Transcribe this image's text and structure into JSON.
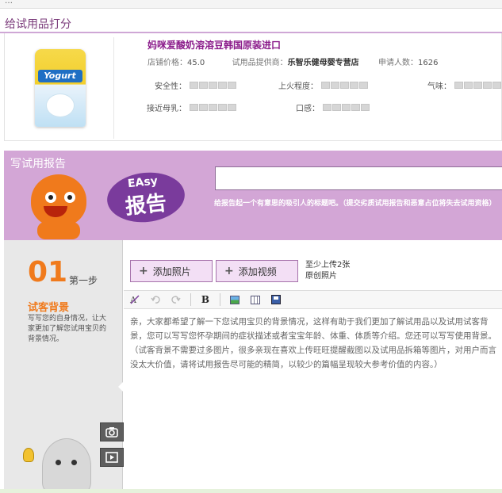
{
  "topbar": {
    "text": "…"
  },
  "trial_product": {
    "section_title": "给试用品打分",
    "name": "妈咪爱酸奶溶溶豆韩国原装进口",
    "package_text": "Yogurt",
    "price_label": "店铺价格：",
    "price": "45.0",
    "supplier_label": "试用品提供商：",
    "supplier": "乐智乐健母婴专营店",
    "applicants_label": "申请人数：",
    "applicants": "1626",
    "ratings": [
      {
        "label": "安全性：",
        "stars": 0
      },
      {
        "label": "上火程度：",
        "stars": 0
      },
      {
        "label": "气味：",
        "stars": 0
      },
      {
        "label": "接近母乳：",
        "stars": 0
      },
      {
        "label": "口感：",
        "stars": 0
      }
    ]
  },
  "report": {
    "banner_title": "写试用报告",
    "badge_top": "EAsy",
    "badge_main": "报告",
    "title_input_value": "",
    "hint": "给报告起一个有意思的吸引人的标题吧。（提交劣质试用报告和恶意占位将失去试用资格）"
  },
  "step": {
    "number": "01",
    "label": "第一步",
    "name": "试客背景",
    "description": "写写您的自身情况，让大家更加了解您试用宝贝的背景情况。"
  },
  "editor": {
    "add_photo_label": "添加照片",
    "add_video_label": "添加视频",
    "upload_note_line1": "至少上传2张",
    "upload_note_line2": "原创照片",
    "toolbar": {
      "bold": "B"
    },
    "body_text": "亲，大家都希望了解一下您试用宝贝的背景情况，这样有助于我们更加了解试用品以及试用试客背景，您可以写写您怀孕期间的症状描述或者宝宝年龄、体重、体质等介绍。您还可以写写使用背景。（试客背景不需要过多图片，很多亲现在喜欢上传旺旺提醒截图以及试用品拆箱等图片，对用户而言没太大价值，请将试用报告尽可能的精简，以较少的篇幅呈现较大参考价值的内容。）"
  },
  "colors": {
    "accent_purple": "#d3a6d6",
    "title_purple": "#8b1c8b",
    "orange": "#f07a1c"
  }
}
